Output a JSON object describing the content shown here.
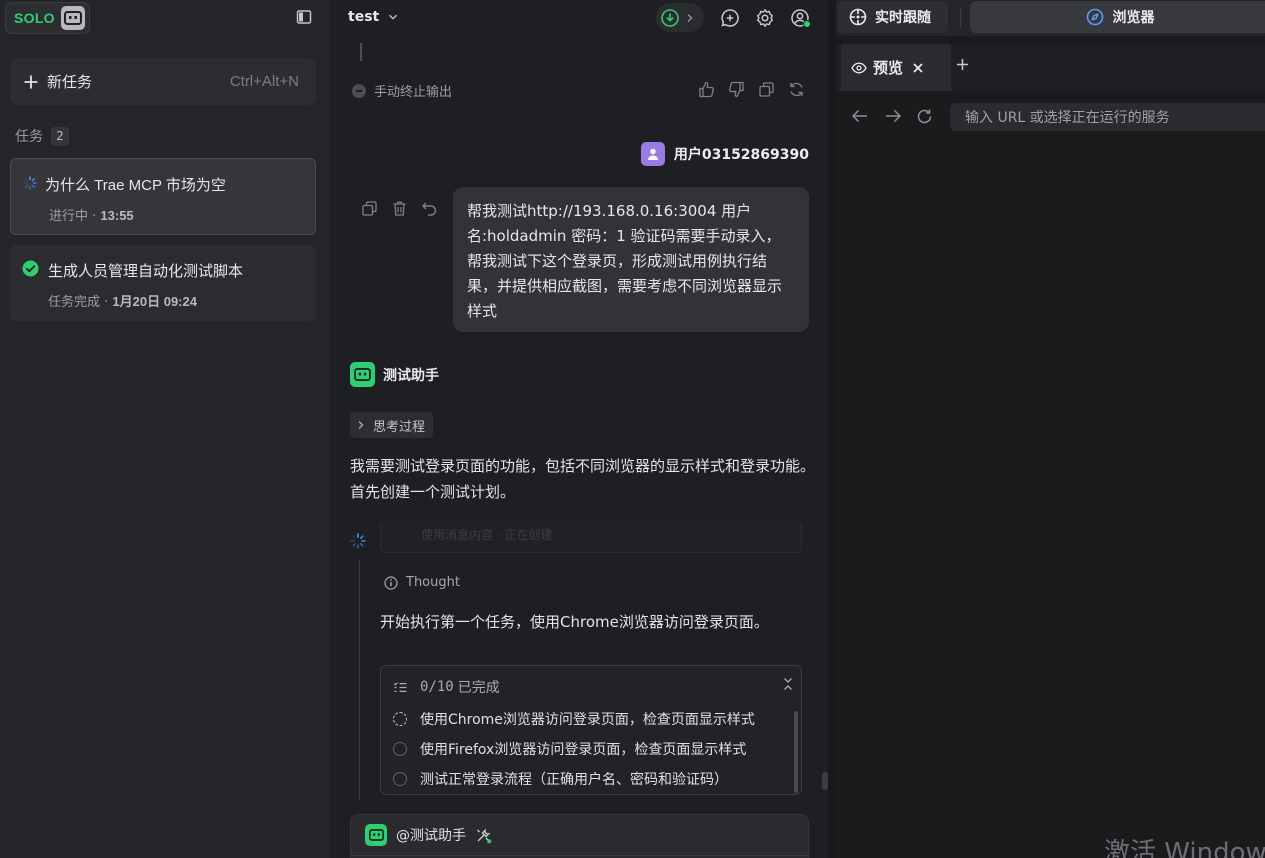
{
  "sidebar": {
    "logo_text": "SOLO",
    "new_task_label": "新任务",
    "new_task_shortcut": "Ctrl+Alt+N",
    "tasks_header": "任务",
    "tasks_count": "2",
    "tasks": [
      {
        "title": "为什么 Trae MCP 市场为空",
        "status_prefix": "进行中 · ",
        "time": "13:55",
        "state": "running"
      },
      {
        "title": "生成人员管理自动化测试脚本",
        "status_prefix": "任务完成 · ",
        "time": "1月20日 09:24",
        "state": "done"
      }
    ]
  },
  "chat": {
    "project_name": "test",
    "stopped_text": "手动终止输出",
    "user_name": "用户03152869390",
    "user_message": "帮我测试http://193.168.0.16:3004 用户名:holdadmin 密码：1  验证码需要手动录入，帮我测试下这个登录页，形成测试用例执行结果，并提供相应截图，需要考虑不同浏览器显示样式",
    "bot_name": "测试助手",
    "thinking_label": "思考过程",
    "bot_paragraph": "我需要测试登录页面的功能，包括不同浏览器的显示样式和登录功能。首先创建一个测试计划。",
    "ghost_text": "使用消息内容 · 正在创建",
    "thought_label": "Thought",
    "exec_text": "开始执行第一个任务，使用Chrome浏览器访问登录页面。",
    "todo_progress": "0/10",
    "todo_done_label": "已完成",
    "todo_items": [
      {
        "text": "使用Chrome浏览器访问登录页面，检查页面显示样式",
        "state": "in-progress"
      },
      {
        "text": "使用Firefox浏览器访问登录页面，检查页面显示样式",
        "state": "pending"
      },
      {
        "text": "测试正常登录流程（正确用户名、密码和验证码）",
        "state": "pending"
      }
    ],
    "input_mention": "@测试助手"
  },
  "right": {
    "tab_follow": "实时跟随",
    "tab_browser": "浏览器",
    "preview_tab": "预览",
    "url_placeholder": "输入 URL 或选择正在运行的服务",
    "watermark": "激活 Windows"
  },
  "colors": {
    "accent_green": "#2fcd74",
    "user_avatar": "#9a7be3",
    "background": "#1e1f22"
  }
}
